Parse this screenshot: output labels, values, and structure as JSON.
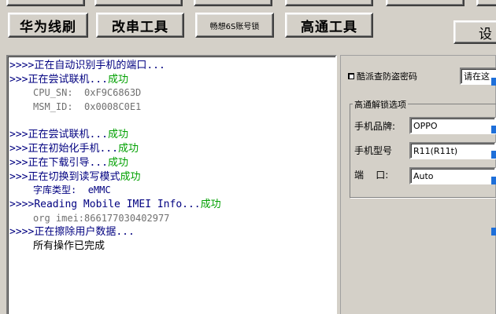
{
  "toolbar": {
    "huawei_flash": "华为线刷",
    "change_serial": "改串工具",
    "changxiang_6s": "畅想6S账号锁",
    "qualcomm": "高通工具",
    "settings": "设"
  },
  "log": {
    "lines": [
      {
        "prefix": ">>>>",
        "text": "正在自动识别手机的端口...",
        "status": ""
      },
      {
        "prefix": ">>>",
        "text": "正在尝试联机...",
        "status": "成功"
      },
      {
        "label": "CPU_SN:",
        "value": "0xF9C6863D"
      },
      {
        "label": "MSM_ID:",
        "value": "0x0008C0E1"
      },
      {
        "prefix": ">>>",
        "text": "正在尝试联机...",
        "status": "成功"
      },
      {
        "prefix": ">>>",
        "text": "正在初始化手机...",
        "status": "成功"
      },
      {
        "prefix": ">>>",
        "text": "正在下载引导...",
        "status": "成功"
      },
      {
        "prefix": ">>>",
        "text": "正在切换到读写模式",
        "status": "成功"
      },
      {
        "label": "字库类型:",
        "value": "eMMC"
      },
      {
        "prefix": ">>>>",
        "text": "Reading Mobile IMEI Info...",
        "status": "成功"
      },
      {
        "label": "org imei:",
        "value": "866177030402977"
      },
      {
        "prefix": ">>>>",
        "text": "正在擦除用户数据..."
      },
      {
        "text": "所有操作已完成"
      }
    ]
  },
  "right": {
    "coolpad_label": "酷派查防盗密码",
    "coolpad_value": "请在这",
    "group_title": "高通解锁选项",
    "brand_label": "手机品牌:",
    "brand_value": "OPPO",
    "model_label": "手机型号",
    "model_value": "R11(R11t)",
    "port_label": "端    口:",
    "port_value": "Auto"
  },
  "colors": {
    "log_blue": "#000080",
    "log_green": "#00a000",
    "accent": "#1e6fd9"
  }
}
